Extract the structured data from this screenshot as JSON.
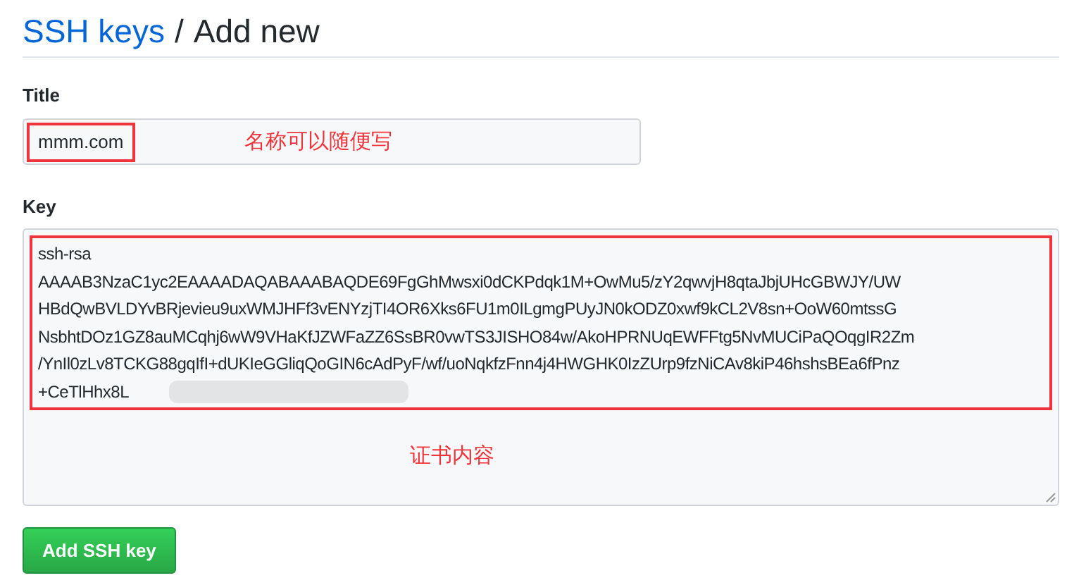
{
  "heading": {
    "link": "SSH keys",
    "separator": "/",
    "title": "Add new"
  },
  "title_field": {
    "label": "Title",
    "value": "mmm.com",
    "annotation": "名称可以随便写"
  },
  "key_field": {
    "label": "Key",
    "value_lines": [
      "ssh-rsa",
      "AAAAB3NzaC1yc2EAAAADAQABAAABAQDE69FgGhMwsxi0dCKPdqk1M+OwMu5/zY2qwvjH8qtaJbjUHcGBWJY/UW",
      "HBdQwBVLDYvBRjevieu9uxWMJHFf3vENYzjTI4OR6Xks6FU1m0ILgmgPUyJN0kODZ0xwf9kCL2V8sn+OoW60mtssG",
      "NsbhtDOz1GZ8auMCqhj6wW9VHaKfJZWFaZZ6SsBR0vwTS3JISHO84w/AkoHPRNUqEWFFtg5NvMUCiPaQOqgIR2Zm",
      "/YnIl0zLv8TCKG88gqIfI+dUKIeGGliqQoGIN6cAdPyF/wf/uoNqkfzFnn4j4HWGHK0IzZUrp9fzNiCAv8kiP46hshsBEa6fPnz",
      "+CeTlHhx8L"
    ],
    "annotation": "证书内容"
  },
  "button": "Add SSH key"
}
